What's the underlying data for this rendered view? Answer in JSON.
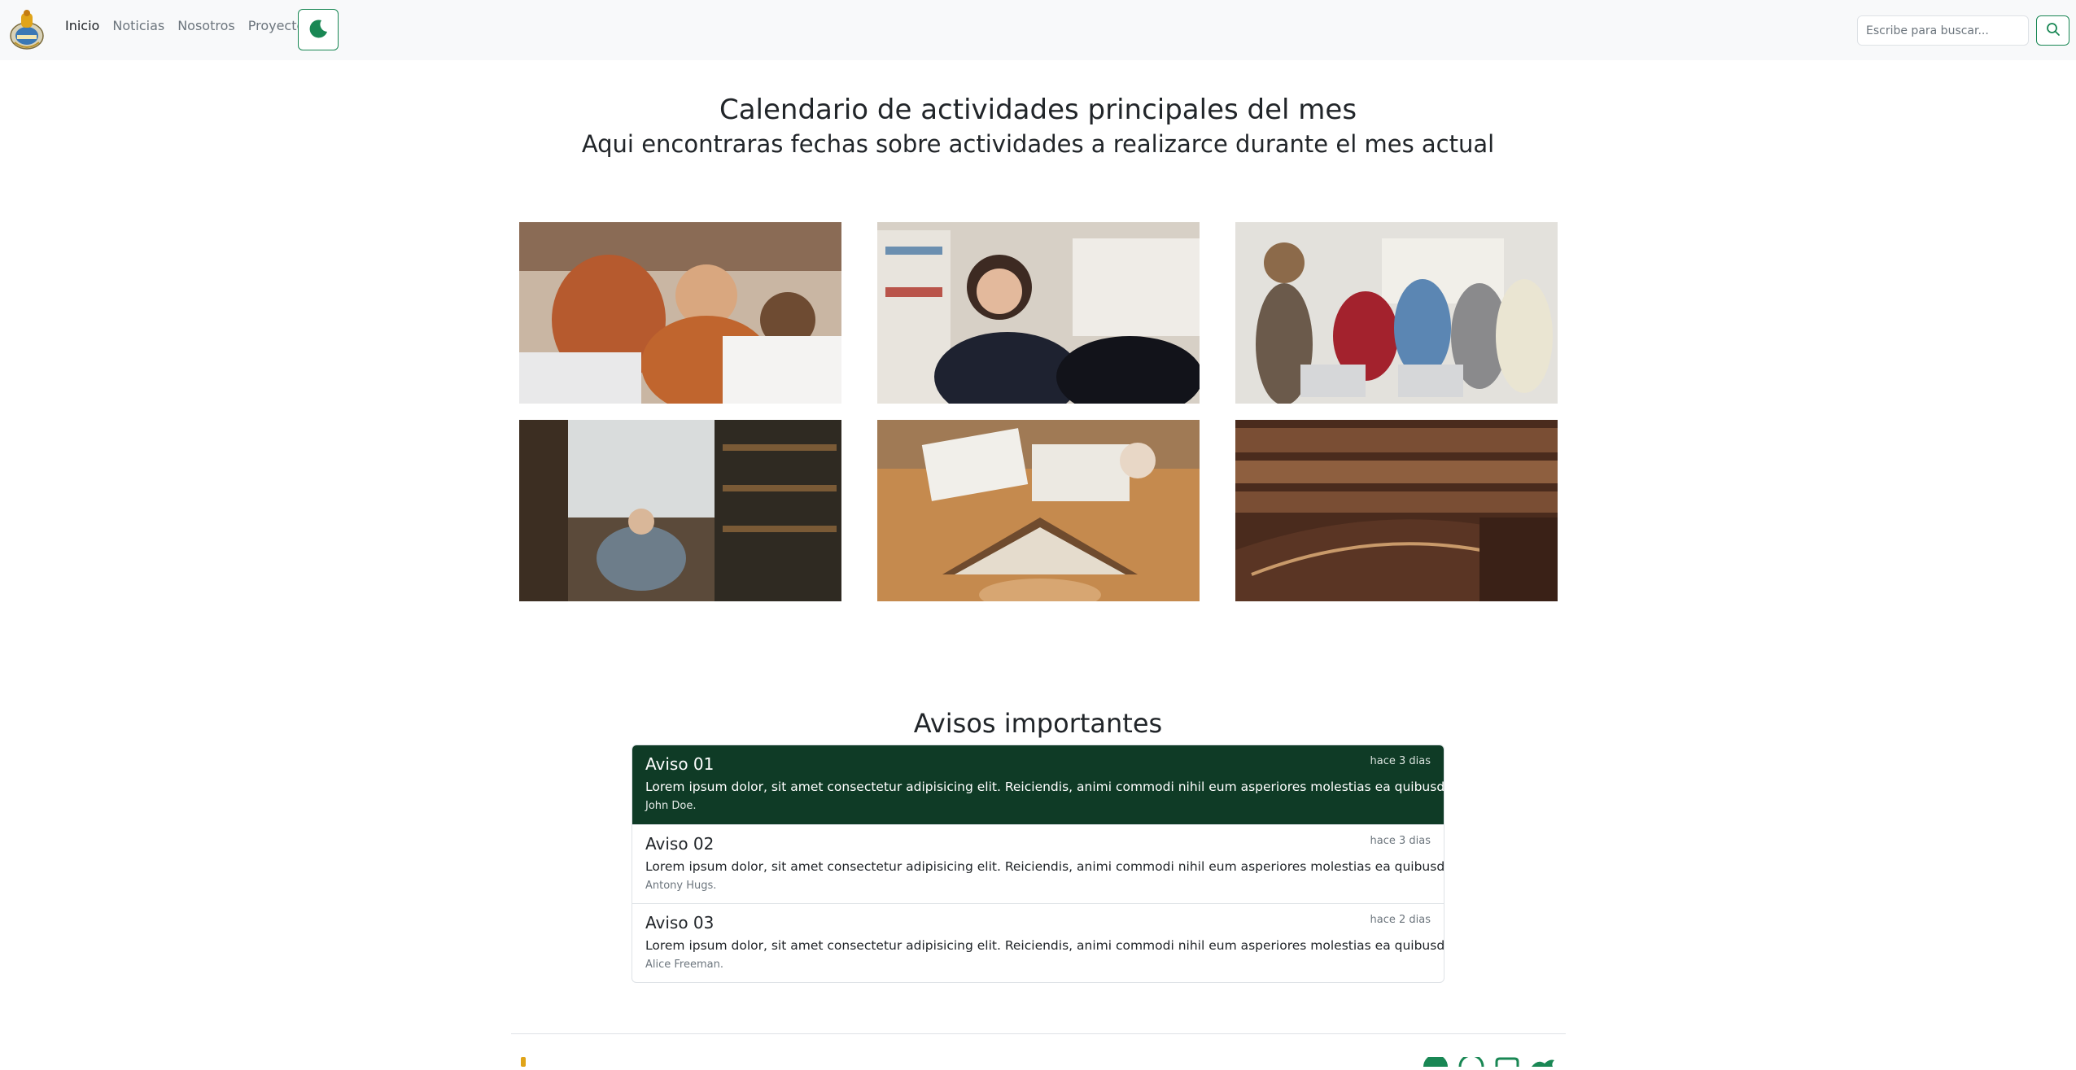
{
  "navbar": {
    "logo_icon": "school-crest-icon",
    "links": [
      {
        "label": "Inicio",
        "active": true
      },
      {
        "label": "Noticias",
        "active": false
      },
      {
        "label": "Nosotros",
        "active": false
      },
      {
        "label": "Proyectos",
        "active": false
      }
    ],
    "theme_toggle_icon": "moon-icon",
    "search": {
      "placeholder": "Escribe para buscar...",
      "value": "",
      "button_icon": "search-icon"
    }
  },
  "hero": {
    "title": "Calendario de actividades principales del mes",
    "subtitle": "Aqui encontraras fechas sobre actividades a realizarce durante el mes actual"
  },
  "gallery": [
    {
      "icon": "students-laptop-photo"
    },
    {
      "icon": "student-thinking-photo"
    },
    {
      "icon": "classroom-celebration-photo"
    },
    {
      "icon": "library-reading-photo"
    },
    {
      "icon": "book-on-head-photo"
    },
    {
      "icon": "circular-library-photo"
    }
  ],
  "avisos": {
    "title": "Avisos importantes",
    "items": [
      {
        "title": "Aviso 01",
        "time": "hace 3 dias",
        "text": "Lorem ipsum dolor, sit amet consectetur adipisicing elit. Reiciendis, animi commodi nihil eum asperiores molestias ea quibusdam pariatur",
        "author": "John Doe.",
        "active": true
      },
      {
        "title": "Aviso 02",
        "time": "hace 3 dias",
        "text": "Lorem ipsum dolor, sit amet consectetur adipisicing elit. Reiciendis, animi commodi nihil eum asperiores molestias ea quibusdam pariatur",
        "author": "Antony Hugs.",
        "active": false
      },
      {
        "title": "Aviso 03",
        "time": "hace 2 dias",
        "text": "Lorem ipsum dolor, sit amet consectetur adipisicing elit. Reiciendis, animi commodi nihil eum asperiores molestias ea quibusdam pariatur",
        "author": "Alice Freeman.",
        "active": false
      }
    ]
  },
  "footer": {
    "social_icons": [
      "whatsapp-icon",
      "messenger-icon",
      "instagram-icon",
      "twitter-icon"
    ]
  },
  "colors": {
    "accent": "#198754",
    "active_item": "#0f3b26",
    "navbar_bg": "#f8f9fa"
  }
}
